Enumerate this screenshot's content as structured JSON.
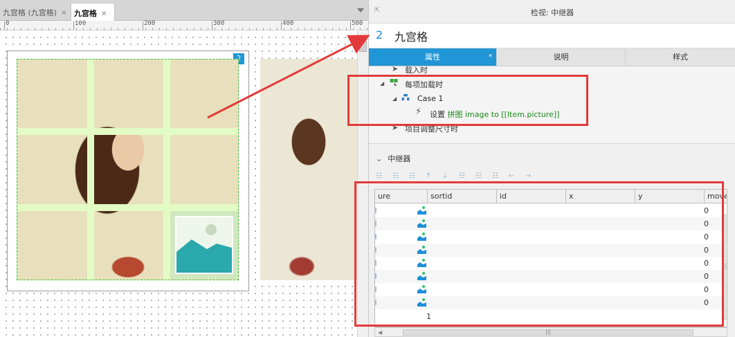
{
  "document_tabs": [
    {
      "label": "九宫格 (九宫格)",
      "active": false
    },
    {
      "label": "九宫格",
      "active": true
    }
  ],
  "ruler": {
    "ticks": [
      "0",
      "100",
      "200",
      "300",
      "400",
      "500"
    ]
  },
  "canvas": {
    "repeater_badge": "2"
  },
  "inspector": {
    "title": "检视: 中继器",
    "widget_number": "2",
    "widget_name": "九宫格",
    "tabs": [
      {
        "label": "属性",
        "active": true,
        "modified_marker": "*"
      },
      {
        "label": "说明",
        "active": false
      },
      {
        "label": "样式",
        "active": false
      }
    ],
    "events": {
      "on_load": "载入时",
      "item_loaded": "每项加载时",
      "case_label": "Case 1",
      "action_prefix": "设置",
      "action_body": "拼图 image to [[Item.picture]]",
      "item_resize": "项目调整尺寸时"
    },
    "section_title": "中继器",
    "dataset": {
      "columns": [
        "ure",
        "sortid",
        "id",
        "x",
        "y",
        "move"
      ],
      "rows": [
        {
          "picture": "image",
          "move": "0"
        },
        {
          "picture": "image",
          "move": "0"
        },
        {
          "picture": "image",
          "move": "0"
        },
        {
          "picture": "image",
          "move": "0"
        },
        {
          "picture": "image",
          "move": "0"
        },
        {
          "picture": "image",
          "move": "0"
        },
        {
          "picture": "image",
          "move": "0"
        },
        {
          "picture": "image",
          "move": "0"
        }
      ],
      "new_row_value": "1"
    }
  },
  "colors": {
    "accent": "#2196d6",
    "annotation_red": "#e23a3a",
    "grid_gap": "#e3fbc4",
    "action_keyword": "#1a8a1a"
  }
}
